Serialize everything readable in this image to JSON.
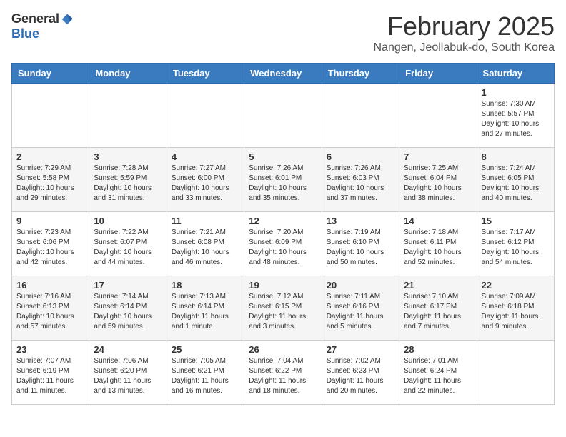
{
  "header": {
    "logo_general": "General",
    "logo_blue": "Blue",
    "month_year": "February 2025",
    "location": "Nangen, Jeollabuk-do, South Korea"
  },
  "days_of_week": [
    "Sunday",
    "Monday",
    "Tuesday",
    "Wednesday",
    "Thursday",
    "Friday",
    "Saturday"
  ],
  "weeks": [
    [
      {
        "day": "",
        "info": ""
      },
      {
        "day": "",
        "info": ""
      },
      {
        "day": "",
        "info": ""
      },
      {
        "day": "",
        "info": ""
      },
      {
        "day": "",
        "info": ""
      },
      {
        "day": "",
        "info": ""
      },
      {
        "day": "1",
        "info": "Sunrise: 7:30 AM\nSunset: 5:57 PM\nDaylight: 10 hours\nand 27 minutes."
      }
    ],
    [
      {
        "day": "2",
        "info": "Sunrise: 7:29 AM\nSunset: 5:58 PM\nDaylight: 10 hours\nand 29 minutes."
      },
      {
        "day": "3",
        "info": "Sunrise: 7:28 AM\nSunset: 5:59 PM\nDaylight: 10 hours\nand 31 minutes."
      },
      {
        "day": "4",
        "info": "Sunrise: 7:27 AM\nSunset: 6:00 PM\nDaylight: 10 hours\nand 33 minutes."
      },
      {
        "day": "5",
        "info": "Sunrise: 7:26 AM\nSunset: 6:01 PM\nDaylight: 10 hours\nand 35 minutes."
      },
      {
        "day": "6",
        "info": "Sunrise: 7:26 AM\nSunset: 6:03 PM\nDaylight: 10 hours\nand 37 minutes."
      },
      {
        "day": "7",
        "info": "Sunrise: 7:25 AM\nSunset: 6:04 PM\nDaylight: 10 hours\nand 38 minutes."
      },
      {
        "day": "8",
        "info": "Sunrise: 7:24 AM\nSunset: 6:05 PM\nDaylight: 10 hours\nand 40 minutes."
      }
    ],
    [
      {
        "day": "9",
        "info": "Sunrise: 7:23 AM\nSunset: 6:06 PM\nDaylight: 10 hours\nand 42 minutes."
      },
      {
        "day": "10",
        "info": "Sunrise: 7:22 AM\nSunset: 6:07 PM\nDaylight: 10 hours\nand 44 minutes."
      },
      {
        "day": "11",
        "info": "Sunrise: 7:21 AM\nSunset: 6:08 PM\nDaylight: 10 hours\nand 46 minutes."
      },
      {
        "day": "12",
        "info": "Sunrise: 7:20 AM\nSunset: 6:09 PM\nDaylight: 10 hours\nand 48 minutes."
      },
      {
        "day": "13",
        "info": "Sunrise: 7:19 AM\nSunset: 6:10 PM\nDaylight: 10 hours\nand 50 minutes."
      },
      {
        "day": "14",
        "info": "Sunrise: 7:18 AM\nSunset: 6:11 PM\nDaylight: 10 hours\nand 52 minutes."
      },
      {
        "day": "15",
        "info": "Sunrise: 7:17 AM\nSunset: 6:12 PM\nDaylight: 10 hours\nand 54 minutes."
      }
    ],
    [
      {
        "day": "16",
        "info": "Sunrise: 7:16 AM\nSunset: 6:13 PM\nDaylight: 10 hours\nand 57 minutes."
      },
      {
        "day": "17",
        "info": "Sunrise: 7:14 AM\nSunset: 6:14 PM\nDaylight: 10 hours\nand 59 minutes."
      },
      {
        "day": "18",
        "info": "Sunrise: 7:13 AM\nSunset: 6:14 PM\nDaylight: 11 hours\nand 1 minute."
      },
      {
        "day": "19",
        "info": "Sunrise: 7:12 AM\nSunset: 6:15 PM\nDaylight: 11 hours\nand 3 minutes."
      },
      {
        "day": "20",
        "info": "Sunrise: 7:11 AM\nSunset: 6:16 PM\nDaylight: 11 hours\nand 5 minutes."
      },
      {
        "day": "21",
        "info": "Sunrise: 7:10 AM\nSunset: 6:17 PM\nDaylight: 11 hours\nand 7 minutes."
      },
      {
        "day": "22",
        "info": "Sunrise: 7:09 AM\nSunset: 6:18 PM\nDaylight: 11 hours\nand 9 minutes."
      }
    ],
    [
      {
        "day": "23",
        "info": "Sunrise: 7:07 AM\nSunset: 6:19 PM\nDaylight: 11 hours\nand 11 minutes."
      },
      {
        "day": "24",
        "info": "Sunrise: 7:06 AM\nSunset: 6:20 PM\nDaylight: 11 hours\nand 13 minutes."
      },
      {
        "day": "25",
        "info": "Sunrise: 7:05 AM\nSunset: 6:21 PM\nDaylight: 11 hours\nand 16 minutes."
      },
      {
        "day": "26",
        "info": "Sunrise: 7:04 AM\nSunset: 6:22 PM\nDaylight: 11 hours\nand 18 minutes."
      },
      {
        "day": "27",
        "info": "Sunrise: 7:02 AM\nSunset: 6:23 PM\nDaylight: 11 hours\nand 20 minutes."
      },
      {
        "day": "28",
        "info": "Sunrise: 7:01 AM\nSunset: 6:24 PM\nDaylight: 11 hours\nand 22 minutes."
      },
      {
        "day": "",
        "info": ""
      }
    ]
  ]
}
